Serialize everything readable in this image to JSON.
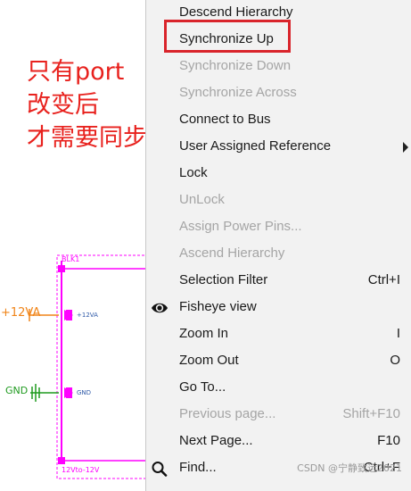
{
  "annotation": {
    "lines": [
      "只有port",
      "改变后",
      "才需要同步"
    ]
  },
  "schematic": {
    "block_label": "BLK1",
    "bottom_label": "12Vto-12V",
    "net_labels": {
      "plus12va": "+12VA",
      "gnd": "GND"
    },
    "pin_labels": {
      "plus12va": "+12VA",
      "gnd": "GND"
    },
    "colors": {
      "block_border": "#ff00ff",
      "net_plus12va": "#f08418",
      "net_gnd": "#1f9a1f",
      "pin_text": "#2f5aa8"
    }
  },
  "menu": {
    "items": [
      {
        "label": "Descend Hierarchy",
        "enabled": true
      },
      {
        "label": "Synchronize Up",
        "enabled": true,
        "highlighted": true
      },
      {
        "label": "Synchronize Down",
        "enabled": false
      },
      {
        "label": "Synchronize Across",
        "enabled": false
      },
      {
        "label": "Connect to Bus",
        "enabled": true
      },
      {
        "label": "User Assigned Reference",
        "enabled": true,
        "submenu": true
      },
      {
        "label": "Lock",
        "enabled": true
      },
      {
        "label": "UnLock",
        "enabled": false
      },
      {
        "label": "Assign Power Pins...",
        "enabled": false
      },
      {
        "label": "Ascend Hierarchy",
        "enabled": false
      },
      {
        "label": "Selection Filter",
        "enabled": true,
        "shortcut": "Ctrl+I"
      },
      {
        "label": "Fisheye view",
        "enabled": true,
        "icon": "eye-icon"
      },
      {
        "label": "Zoom In",
        "enabled": true,
        "shortcut": "I"
      },
      {
        "label": "Zoom Out",
        "enabled": true,
        "shortcut": "O"
      },
      {
        "label": "Go To...",
        "enabled": true
      },
      {
        "label": "Previous page...",
        "enabled": false,
        "shortcut": "Shift+F10"
      },
      {
        "label": "Next Page...",
        "enabled": true,
        "shortcut": "F10"
      },
      {
        "label": "Find...",
        "enabled": true,
        "shortcut": "Ctrl+F",
        "icon": "magnifier-icon"
      }
    ],
    "highlight_color": "#d9242b"
  },
  "watermark": "CSDN @宁静致远2021"
}
